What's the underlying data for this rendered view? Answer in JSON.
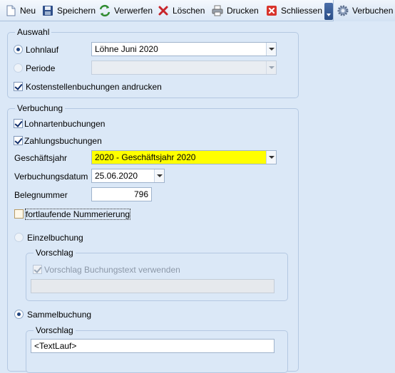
{
  "toolbar": {
    "new_label": "Neu",
    "save_label": "Speichern",
    "discard_label": "Verwerfen",
    "delete_label": "Löschen",
    "print_label": "Drucken",
    "close_label": "Schliessen",
    "post_label": "Verbuchen"
  },
  "auswahl": {
    "legend": "Auswahl",
    "lohnlauf_label": "Lohnlauf",
    "lohnlauf_value": "Löhne Juni 2020",
    "lohnlauf_selected": true,
    "periode_label": "Periode",
    "periode_value": "",
    "kostenstellen_label": "Kostenstellenbuchungen andrucken",
    "kostenstellen_checked": true
  },
  "verbuchung": {
    "legend": "Verbuchung",
    "lohnarten_label": "Lohnartenbuchungen",
    "lohnarten_checked": true,
    "zahlungs_label": "Zahlungsbuchungen",
    "zahlungs_checked": true,
    "geschaeftsjahr_label": "Geschäftsjahr",
    "geschaeftsjahr_value": "2020 - Geschäftsjahr 2020",
    "geschaeftsjahr_highlight": "#ffff00",
    "datum_label": "Verbuchungsdatum",
    "datum_value": "25.06.2020",
    "beleg_label": "Belegnummer",
    "beleg_value": "796",
    "fortlaufend_label": "fortlaufende Nummerierung",
    "fortlaufend_checked": false,
    "einzel_label": "Einzelbuchung",
    "einzel_selected": false,
    "einzel_vorschlag_legend": "Vorschlag",
    "einzel_vorschlag_check_label": "Vorschlag Buchungstext verwenden",
    "einzel_vorschlag_checked": true,
    "einzel_vorschlag_text": "",
    "sammel_label": "Sammelbuchung",
    "sammel_selected": true,
    "sammel_vorschlag_legend": "Vorschlag",
    "sammel_vorschlag_text": "<TextLauf>"
  }
}
